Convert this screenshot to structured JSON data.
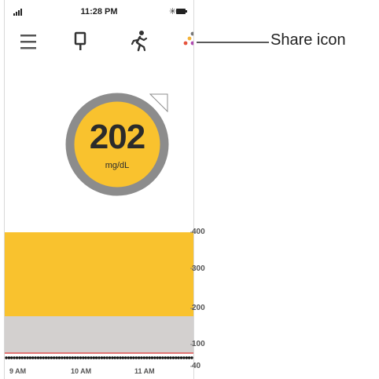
{
  "status_bar": {
    "time": "11:28 PM",
    "icons": [
      "signal-icon",
      "bluetooth-icon",
      "battery-icon"
    ]
  },
  "nav": {
    "icons": [
      "menu-icon",
      "sensor-icon",
      "activity-icon",
      "share-icon"
    ]
  },
  "reading": {
    "value": "202",
    "unit": "mg/dL",
    "ring_color": "#8c8c8c",
    "fill_color": "#f9c22e"
  },
  "graph": {
    "y_ticks": [
      "400",
      "300",
      "200",
      "100",
      "40"
    ],
    "x_ticks": [
      "9 AM",
      "10 AM",
      "11 AM"
    ],
    "high_zone_color": "#f9c22e",
    "target_zone_color": "#d3d0cf",
    "low_line_color": "#e05050",
    "trend_dots_color": "#111111"
  },
  "callout": {
    "label": "Share icon"
  }
}
